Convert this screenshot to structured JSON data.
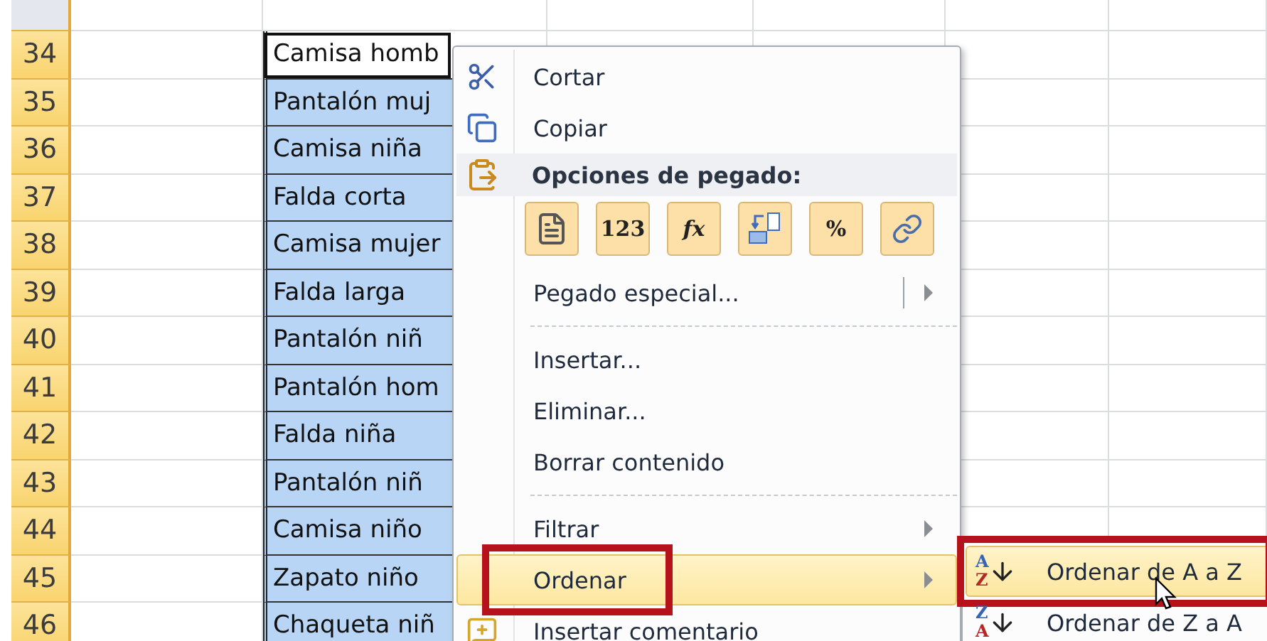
{
  "sheet": {
    "rows": [
      {
        "number": "34",
        "cell": "Camisa homb",
        "active": true
      },
      {
        "number": "35",
        "cell": "Pantalón muj",
        "active": false
      },
      {
        "number": "36",
        "cell": "Camisa niña",
        "active": false
      },
      {
        "number": "37",
        "cell": "Falda corta",
        "active": false
      },
      {
        "number": "38",
        "cell": "Camisa mujer",
        "active": false
      },
      {
        "number": "39",
        "cell": "Falda larga",
        "active": false
      },
      {
        "number": "40",
        "cell": "Pantalón niñ",
        "active": false
      },
      {
        "number": "41",
        "cell": "Pantalón hom",
        "active": false
      },
      {
        "number": "42",
        "cell": "Falda niña",
        "active": false
      },
      {
        "number": "43",
        "cell": "Pantalón niñ",
        "active": false
      },
      {
        "number": "44",
        "cell": "Camisa niño",
        "active": false
      },
      {
        "number": "45",
        "cell": "Zapato niño",
        "active": false
      },
      {
        "number": "46",
        "cell": "Chaqueta niñ",
        "active": false
      }
    ]
  },
  "context_menu": {
    "items": [
      {
        "kind": "item",
        "label": "Cortar",
        "icon": true,
        "submenu": false,
        "selected": false,
        "annotated": false
      },
      {
        "kind": "item",
        "label": "Copiar",
        "icon": true,
        "submenu": false,
        "selected": false,
        "annotated": false
      },
      {
        "kind": "header",
        "label": "Opciones de pegado:",
        "icon": true
      },
      {
        "kind": "paste",
        "options": [
          {
            "kind": "document"
          },
          {
            "kind": "text",
            "label": "123"
          },
          {
            "kind": "formula",
            "label": "fx"
          },
          {
            "kind": "transpose"
          },
          {
            "kind": "format",
            "label": "%"
          },
          {
            "kind": "link"
          }
        ]
      },
      {
        "kind": "item",
        "label": "Pegado especial...",
        "icon": false,
        "submenu": true,
        "split": true,
        "selected": false,
        "annotated": false
      },
      {
        "kind": "separator"
      },
      {
        "kind": "item",
        "label": "Insertar...",
        "icon": false,
        "submenu": false,
        "selected": false,
        "annotated": false
      },
      {
        "kind": "item",
        "label": "Eliminar...",
        "icon": false,
        "submenu": false,
        "selected": false,
        "annotated": false
      },
      {
        "kind": "item",
        "label": "Borrar contenido",
        "icon": false,
        "submenu": false,
        "selected": false,
        "annotated": false
      },
      {
        "kind": "separator"
      },
      {
        "kind": "item",
        "label": "Filtrar",
        "icon": false,
        "submenu": true,
        "selected": false,
        "annotated": false
      },
      {
        "kind": "item",
        "label": "Ordenar",
        "icon": false,
        "submenu": true,
        "selected": true,
        "annotated": true
      },
      {
        "kind": "item",
        "label": "Insertar comentario",
        "icon": true,
        "submenu": false,
        "selected": false,
        "annotated": false
      }
    ]
  },
  "submenu": {
    "items": [
      {
        "label": "Ordenar de A a Z",
        "top_letter": "A",
        "bottom_letter": "Z",
        "selected": true,
        "annotated": true
      },
      {
        "label": "Ordenar de Z a A",
        "top_letter": "Z",
        "bottom_letter": "A",
        "selected": false,
        "annotated": false
      }
    ]
  }
}
